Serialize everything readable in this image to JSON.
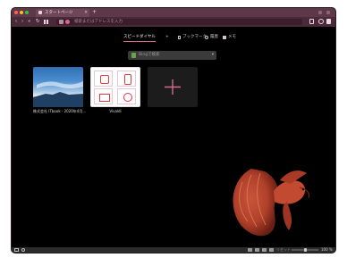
{
  "window": {
    "tab_title": "スタートページ",
    "tab_close": "✕",
    "new_tab": "+"
  },
  "toolbar": {
    "back": "‹",
    "forward": "›",
    "rewind": "«",
    "reload": "↻",
    "url_placeholder": "検索またはアドレスを入力"
  },
  "speed_dial_tabs": [
    {
      "label": "スピードダイヤル"
    },
    {
      "label": "+"
    },
    {
      "label": "ブックマーク"
    },
    {
      "label": "履歴"
    },
    {
      "label": "メモ"
    }
  ],
  "search": {
    "placeholder": "Bingで検索",
    "chevron": "▾"
  },
  "dials": [
    {
      "label": "株式会社 ITbook - 2020年4月…"
    },
    {
      "label": "Vivaldi"
    }
  ],
  "statusbar": {
    "reset": "リセット",
    "zoom": "100 %"
  },
  "colors": {
    "accent": "#d46a8c",
    "titlebar": "#5e3848",
    "toolbar": "#4a2a38",
    "background": "#000000"
  }
}
